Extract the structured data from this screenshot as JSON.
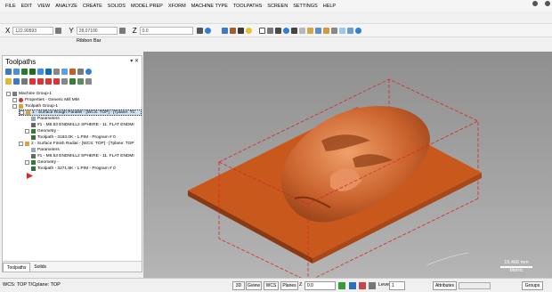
{
  "menu": [
    "FILE",
    "EDIT",
    "VIEW",
    "ANALYZE",
    "CREATE",
    "SOLIDS",
    "MODEL PREP",
    "XFORM",
    "MACHINE TYPE",
    "TOOLPATHS",
    "SCREEN",
    "SETTINGS",
    "HELP"
  ],
  "coords": {
    "x_label": "X",
    "x_value": "122.90593",
    "y_label": "Y",
    "y_value": "28.07100",
    "z_label": "Z",
    "z_value": "0.0"
  },
  "ribbon_bar_label": "Ribbon Bar",
  "panel": {
    "title": "Toolpaths",
    "controls": "▾ ✕",
    "tabs": [
      "Toolpaths",
      "Solids"
    ]
  },
  "tree": {
    "machine_group": "Machine Group-1",
    "properties": "Properties - Generic Mill MM",
    "toolpath_group": "Toolpath Group-1",
    "op1": "1 - Surface Rough Parallel - [WCS: TOP] - [Tplane: TC",
    "op1_params": "Parameters",
    "op1_tool": "#1 - M6.53 ENDMILL2 SPHERE - 11. FLAT ENDMI",
    "op1_geometry": "Geometry -",
    "op1_toolpath": "Toolpath - 3163.0K - 1.PIM - Program # 0",
    "op2": "2 - Surface Finish Radial - [WCS: TOP] - [Tplane: TOP",
    "op2_params": "Parameters",
    "op2_tool": "#1 - M6.53 ENDMILL2 SPHERE - 11. FLAT ENDMI",
    "op2_geometry": "Geometry -",
    "op2_toolpath": "Toolpath - 3271.9K - 1.PIM - Program # 0"
  },
  "scale": {
    "value": "19.466 mm",
    "unit": "Metric"
  },
  "status": {
    "wcs": "WCS: TOP   T/Cplane: TOP",
    "btn_3d": "3D",
    "btn_gview": "Gview",
    "btn_wcs": "WCS",
    "btn_planes": "Planes",
    "z_label": "Z",
    "z_value": "0.0",
    "level_label": "Level",
    "level_value": "1",
    "attributes": "Attributes",
    "groups": "Groups"
  },
  "colors": {
    "part": "#d9692a",
    "stock_line": "#d62828",
    "selected_row": "#cfe3f7"
  }
}
